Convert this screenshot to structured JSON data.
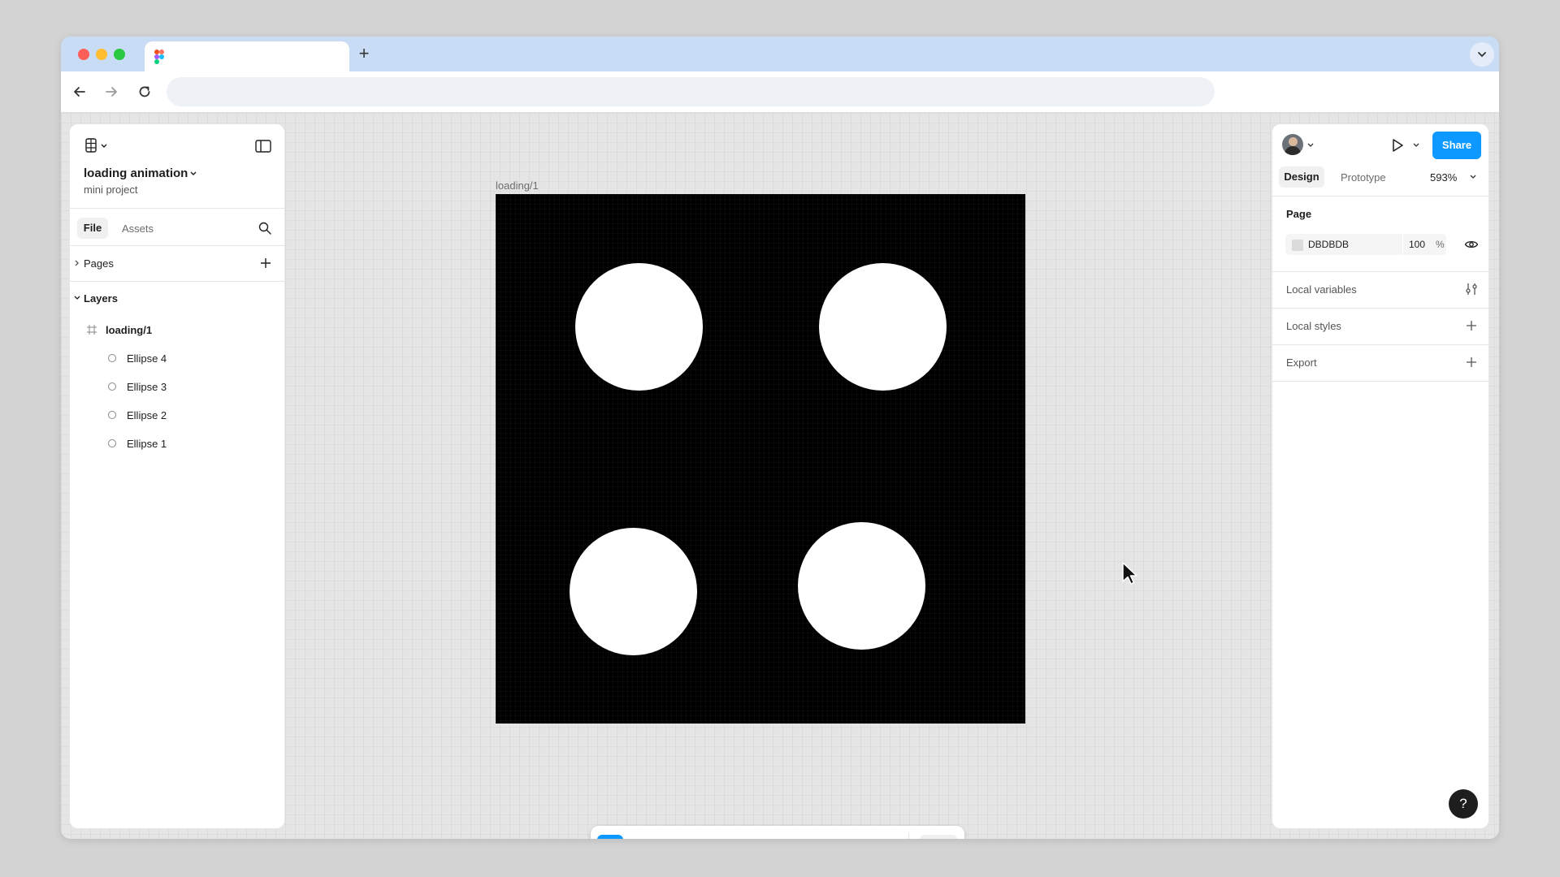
{
  "file": {
    "name": "loading animation",
    "project": "mini project"
  },
  "left_tabs": {
    "file": "File",
    "assets": "Assets"
  },
  "sections": {
    "pages": "Pages",
    "layers": "Layers"
  },
  "layers": {
    "frame": "loading/1",
    "items": [
      "Ellipse 4",
      "Ellipse 3",
      "Ellipse 2",
      "Ellipse 1"
    ]
  },
  "canvas": {
    "frame_label": "loading/1",
    "frame_color": "#000000",
    "ellipse_color": "#FFFFFF"
  },
  "right_panel": {
    "share": "Share",
    "tabs": {
      "design": "Design",
      "prototype": "Prototype"
    },
    "zoom": "593%",
    "page": {
      "heading": "Page",
      "color": "DBDBDB",
      "color_hex": "#DBDBDB",
      "opacity": "100",
      "opacity_unit": "%"
    },
    "sections": {
      "local_variables": "Local variables",
      "local_styles": "Local styles",
      "export": "Export"
    }
  },
  "help": "?",
  "icons": {
    "browser": [
      "favicon-icon",
      "new-tab-icon",
      "chevron-down-icon",
      "back-icon",
      "forward-icon",
      "reload-icon"
    ],
    "toolbar": [
      "move-tool-icon",
      "frame-tool-icon",
      "ellipse-tool-icon",
      "pen-tool-icon",
      "text-tool-icon",
      "comment-tool-icon",
      "actions-icon",
      "dev-mode-icon"
    ]
  },
  "colors": {
    "accent": "#0D99FF"
  }
}
